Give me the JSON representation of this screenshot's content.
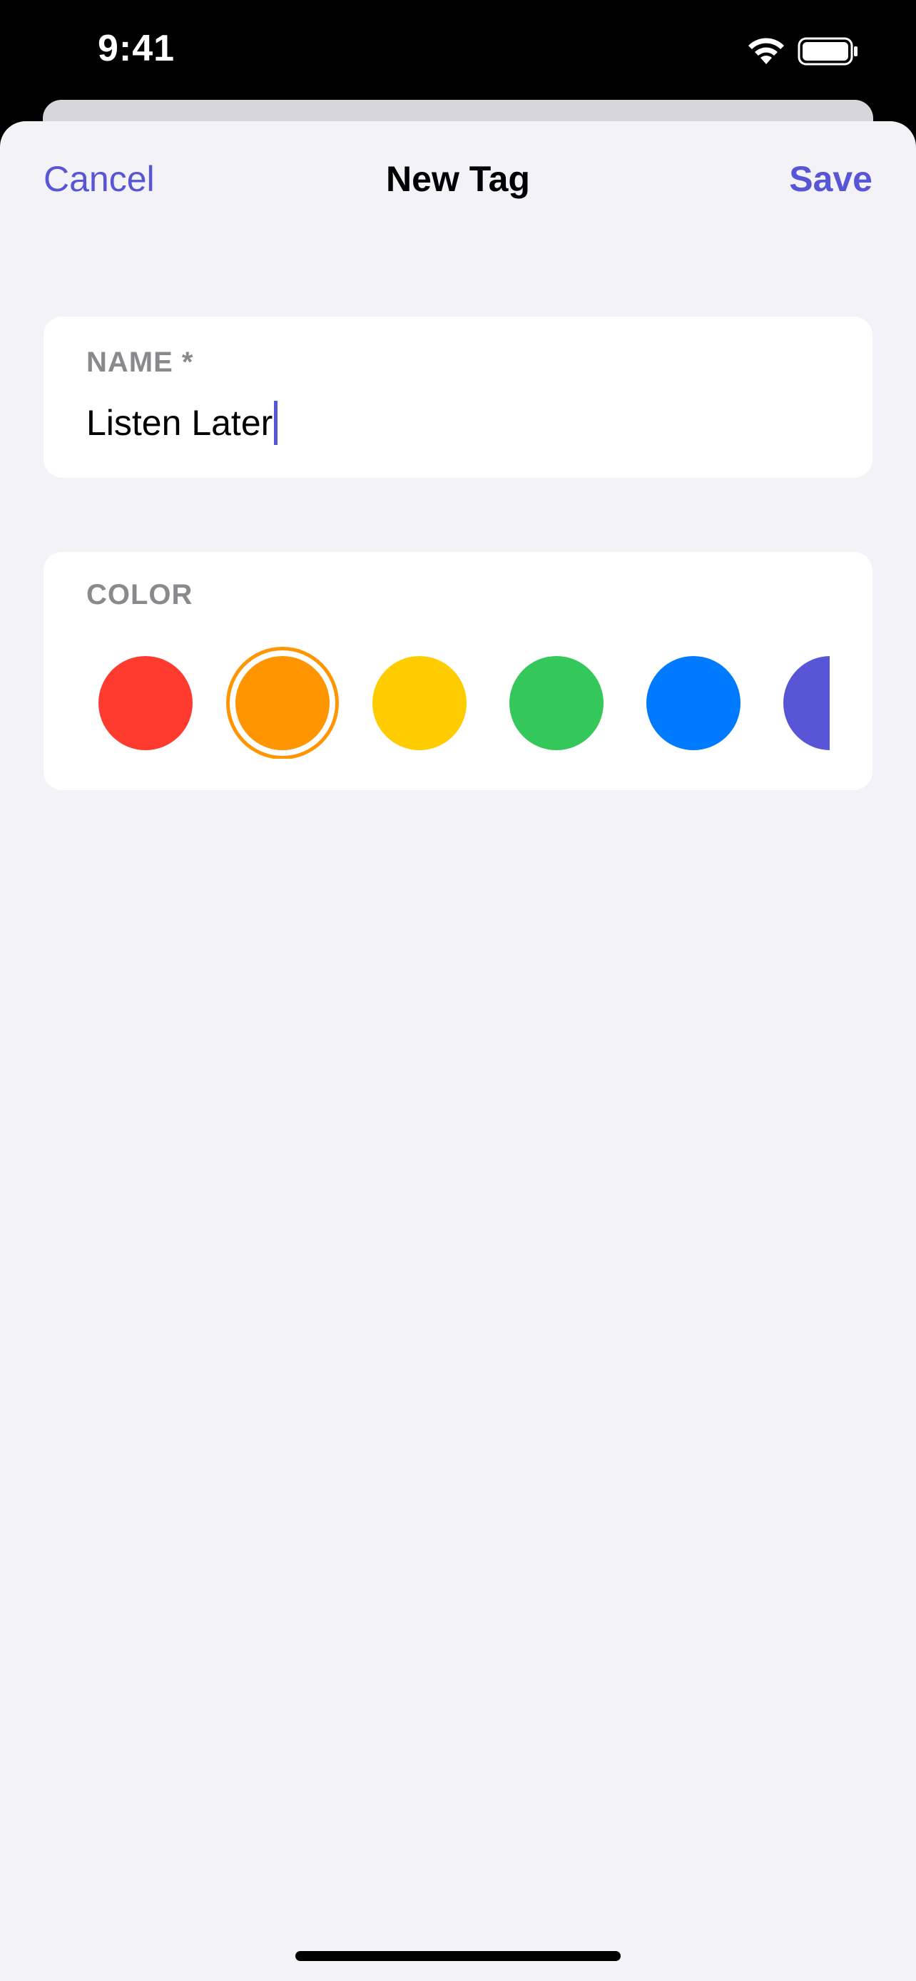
{
  "status_bar": {
    "time": "9:41",
    "icons": [
      "wifi-icon",
      "battery-icon"
    ]
  },
  "nav": {
    "cancel_label": "Cancel",
    "title": "New Tag",
    "save_label": "Save"
  },
  "name_section": {
    "label": "NAME *",
    "value": "Listen Later"
  },
  "color_section": {
    "label": "COLOR",
    "swatches": [
      {
        "name": "red",
        "color": "#ff3b30",
        "selected": false
      },
      {
        "name": "orange",
        "color": "#ff9500",
        "selected": true
      },
      {
        "name": "yellow",
        "color": "#ffcc00",
        "selected": false
      },
      {
        "name": "green",
        "color": "#34c759",
        "selected": false
      },
      {
        "name": "blue",
        "color": "#007aff",
        "selected": false
      },
      {
        "name": "indigo",
        "color": "#5856d6",
        "selected": false
      }
    ]
  },
  "colors": {
    "accent": "#5856d6",
    "background": "#f2f2f7",
    "card": "#ffffff",
    "secondary_text": "#8a8a8e"
  }
}
